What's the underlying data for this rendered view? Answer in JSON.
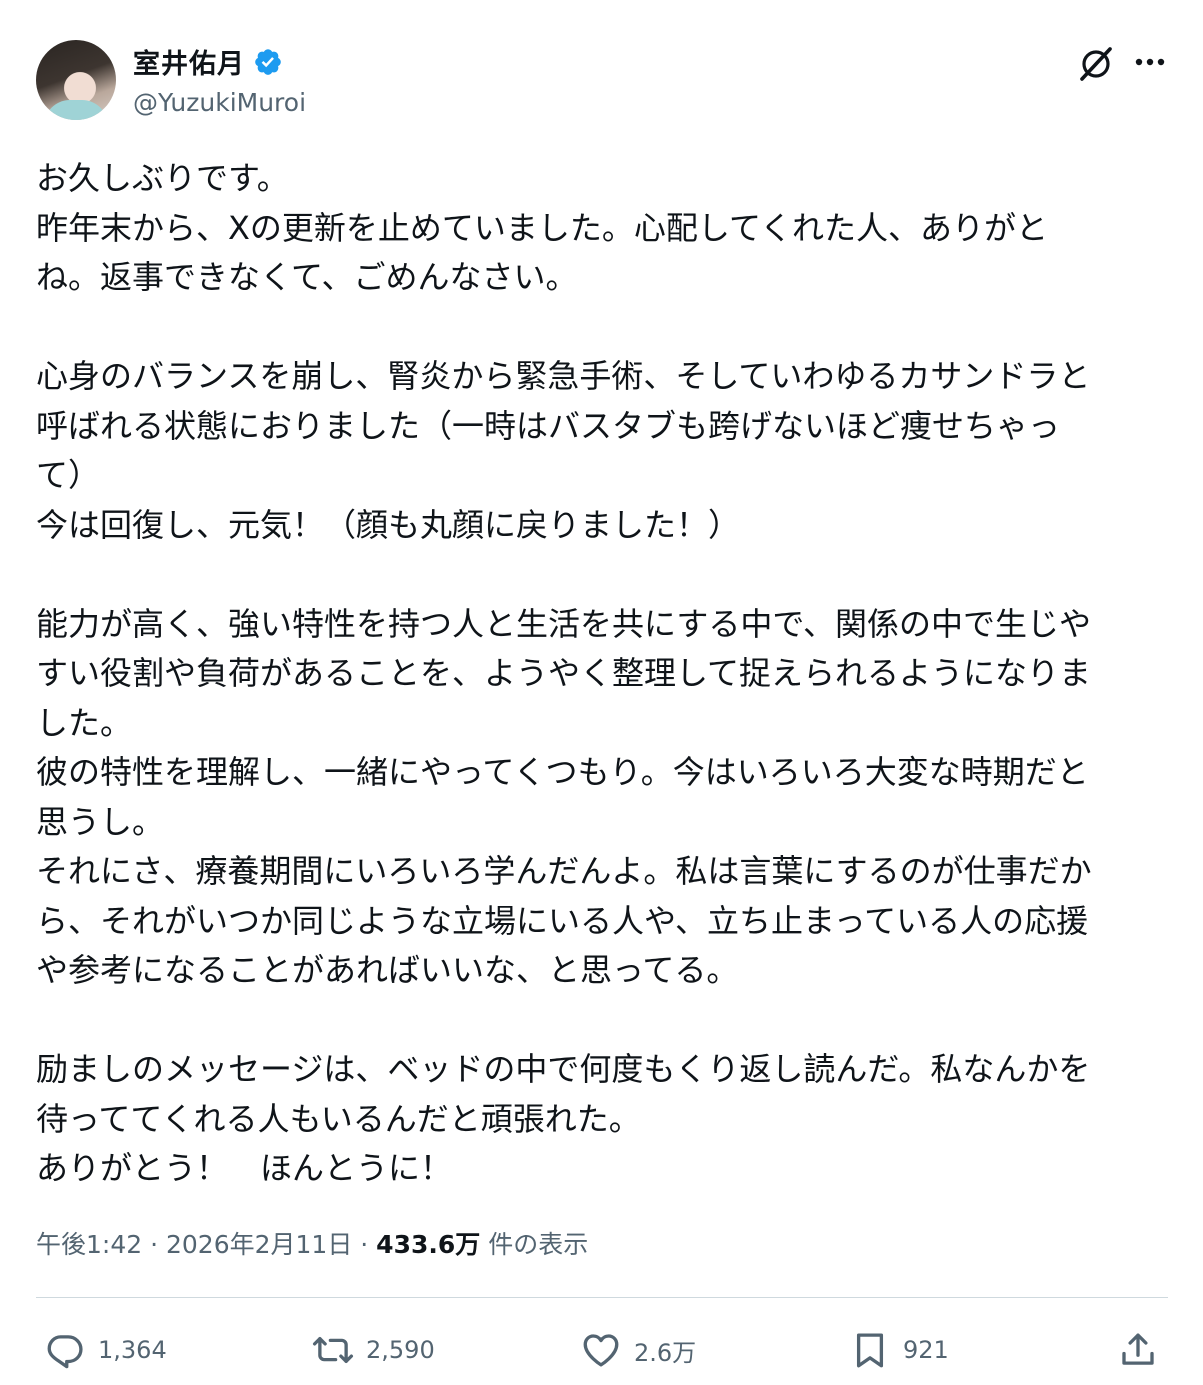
{
  "author": {
    "name": "室井佑月",
    "handle": "@YuzukiMuroi",
    "verified_color": "#1d9bf0"
  },
  "tweet": {
    "text": "お久しぶりです。\n昨年末から、Xの更新を止めていました。心配してくれた人、ありがと\nね。返事できなくて、ごめんなさい。\n\n心身のバランスを崩し、腎炎から緊急手術、そしていわゆるカサンドラと\n呼ばれる状態におりました（一時はバスタブも跨げないほど痩せちゃっ\nて）\n今は回復し、元気！（顔も丸顔に戻りました！）\n\n能力が高く、強い特性を持つ人と生活を共にする中で、関係の中で生じや\nすい役割や負荷があることを、ようやく整理して捉えられるようになりま\nした。\n彼の特性を理解し、一緒にやってくつもり。今はいろいろ大変な時期だと\n思うし。\nそれにさ、療養期間にいろいろ学んだんよ。私は言葉にするのが仕事だか\nら、それがいつか同じような立場にいる人や、立ち止まっている人の応援\nや参考になることがあればいいな、と思ってる。\n\n励ましのメッセージは、ベッドの中で何度もくり返し読んだ。私なんかを\n待っててくれる人もいるんだと頑張れた。\nありがとう！　ほんとうに！"
  },
  "meta": {
    "time": "午後1:42",
    "sep1": " · ",
    "date": "2026年2月11日",
    "sep2": " · ",
    "views": "433.6万",
    "views_suffix": " 件の表示"
  },
  "actions": {
    "reply_count": "1,364",
    "repost_count": "2,590",
    "like_count": "2.6万",
    "bookmark_count": "921"
  },
  "icons": {
    "grok": "grok-icon",
    "more": "more-icon",
    "reply": "reply-icon",
    "repost": "repost-icon",
    "like": "heart-icon",
    "bookmark": "bookmark-icon",
    "share": "share-icon"
  },
  "colors": {
    "text": "#0f1419",
    "secondary": "#536471",
    "divider": "#cfd9de",
    "verified": "#1d9bf0"
  }
}
